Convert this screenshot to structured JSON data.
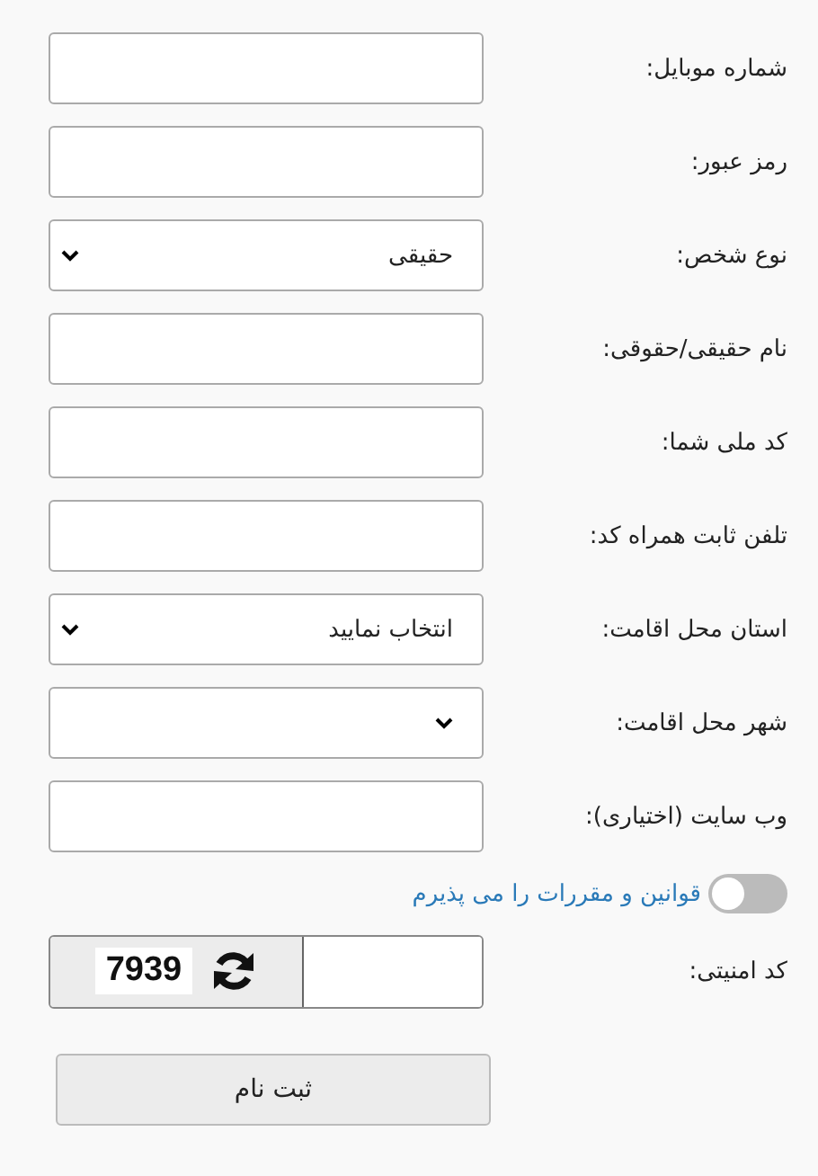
{
  "fields": [
    {
      "label": "شماره موبایل:",
      "kind": "text"
    },
    {
      "label": "رمز عبور:",
      "kind": "text"
    },
    {
      "label": "نوع شخص:",
      "kind": "select",
      "value": "حقیقی"
    },
    {
      "label": "نام حقیقی/حقوقی:",
      "kind": "text"
    },
    {
      "label": "کد ملی شما:",
      "kind": "text"
    },
    {
      "label": "تلفن ثابت همراه کد:",
      "kind": "text"
    },
    {
      "label": "استان محل اقامت:",
      "kind": "select",
      "value": "انتخاب نمایید"
    },
    {
      "label": "شهر محل اقامت:",
      "kind": "select"
    },
    {
      "label": "وب سایت (اختیاری):",
      "kind": "text"
    }
  ],
  "agreement": {
    "label": "قوانین و مقررات را می پذیرم",
    "on": false
  },
  "captcha": {
    "label": "کد امنیتی:",
    "code": "7939"
  },
  "submit": "ثبت نام"
}
